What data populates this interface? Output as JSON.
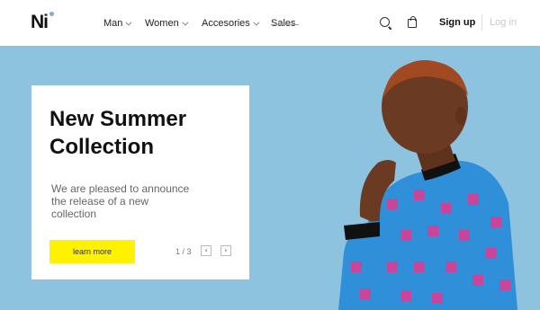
{
  "header": {
    "logo": "Ni",
    "nav": [
      {
        "label": "Man"
      },
      {
        "label": "Women"
      },
      {
        "label": "Accesories"
      },
      {
        "label": "Sales"
      }
    ],
    "signup": "Sign up",
    "login": "Log in"
  },
  "hero": {
    "title": "New Summer Collection",
    "text": "We are pleased to announce the release of a new collection",
    "button": "learn more",
    "pager": "1 / 3",
    "prev_icon": "‹",
    "next_icon": "›"
  },
  "colors": {
    "hero_bg": "#8ec3e0",
    "button_bg": "#fff200",
    "accent": "#6fb3d9",
    "jacket": "#2f8fd8",
    "skin": "#6b3a22"
  }
}
